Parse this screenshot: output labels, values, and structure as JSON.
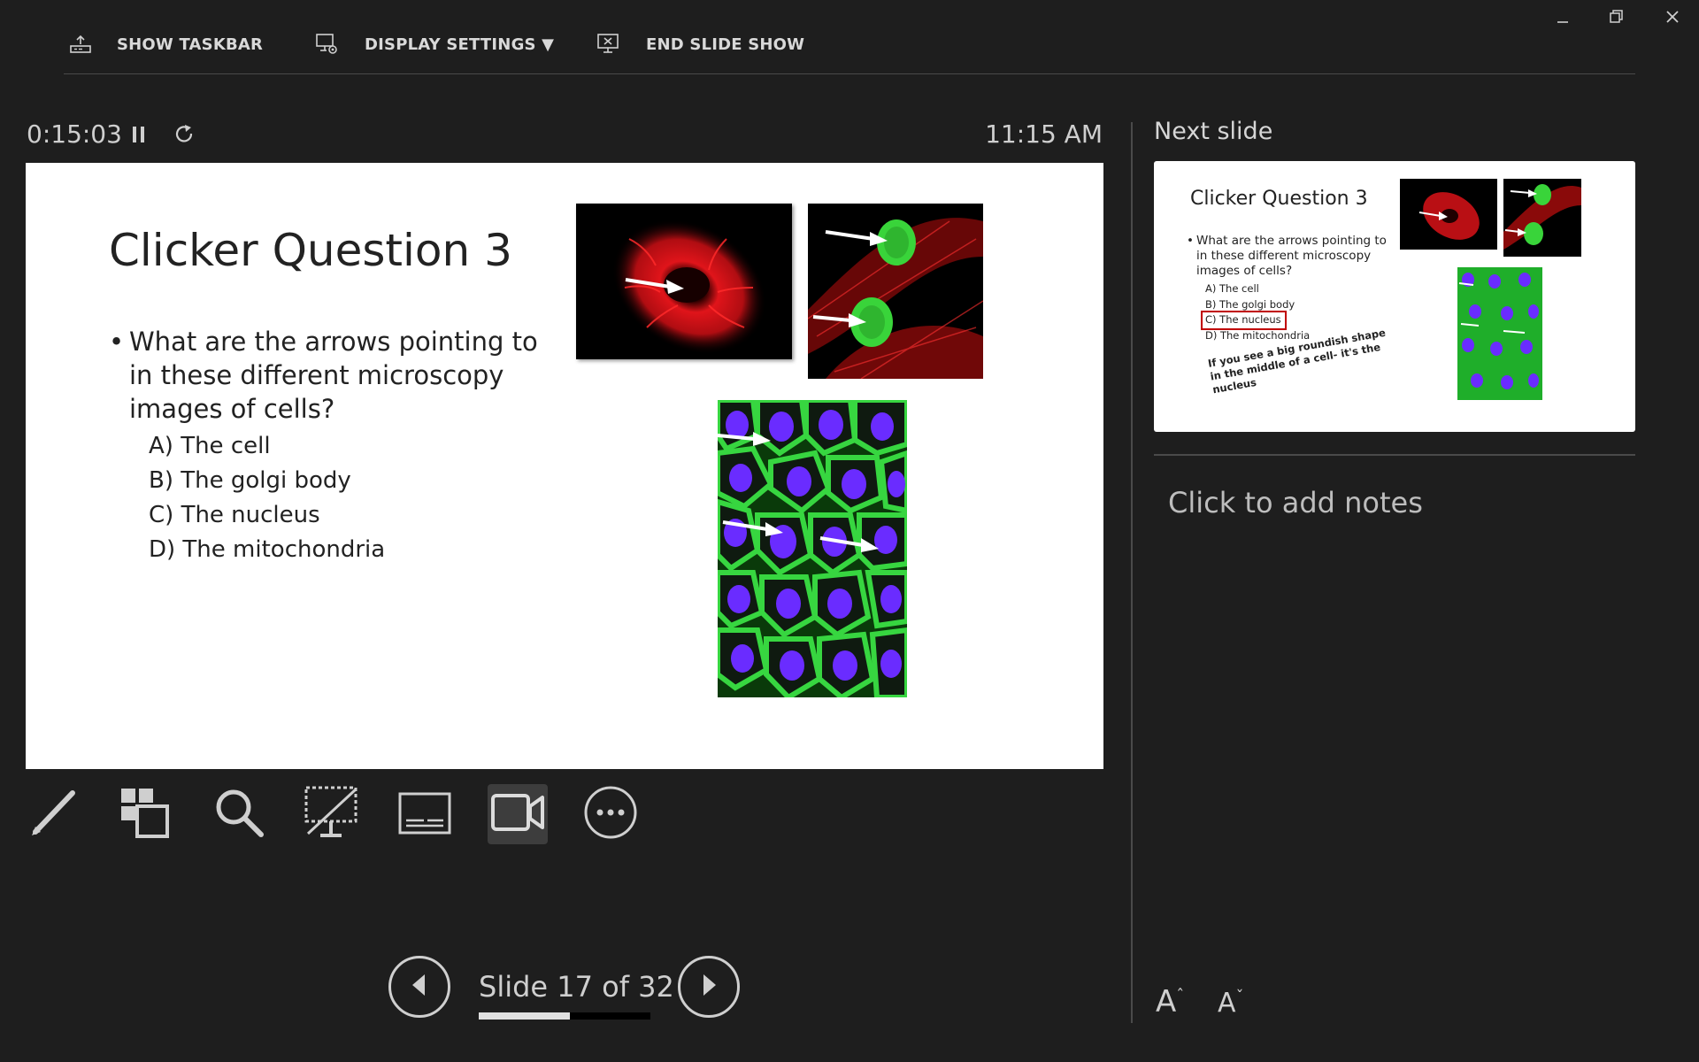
{
  "toolbar": {
    "show_taskbar": "SHOW TASKBAR",
    "display_settings": "DISPLAY SETTINGS ▼",
    "end_slide_show": "END SLIDE SHOW"
  },
  "timer": {
    "elapsed": "0:15:03",
    "clock": "11:15 AM"
  },
  "current_slide": {
    "title": "Clicker Question 3",
    "question": "What are the arrows pointing to in these different microscopy images of cells?",
    "options": [
      "A) The cell",
      "B) The golgi body",
      "C) The nucleus",
      "D) The mitochondria"
    ]
  },
  "next_slide": {
    "label": "Next slide",
    "title": "Clicker Question 3",
    "question": "What are the arrows pointing to in these different microscopy images of cells?",
    "options": [
      "A) The cell",
      "B) The golgi body",
      "C) The nucleus",
      "D) The mitochondria"
    ],
    "hint": "If you see a big roundish shape in the middle of a cell- it's the nucleus"
  },
  "notes": {
    "placeholder": "Click to add notes"
  },
  "navigation": {
    "slide_counter": "Slide 17 of 32",
    "progress": 0.53
  },
  "font_controls": {
    "increase": "A",
    "decrease": "A"
  },
  "icons": [
    "taskbar-icon",
    "display-settings-icon",
    "end-show-icon",
    "minimize-icon",
    "restore-icon",
    "close-icon",
    "pause-icon",
    "restart-icon",
    "pen-icon",
    "see-all-slides-icon",
    "zoom-icon",
    "black-screen-icon",
    "subtitles-icon",
    "camera-icon",
    "more-options-icon",
    "previous-icon",
    "next-icon"
  ],
  "colors": {
    "background": "#1e1e1e",
    "slide_bg": "#ffffff",
    "answer_highlight": "#c00000"
  }
}
